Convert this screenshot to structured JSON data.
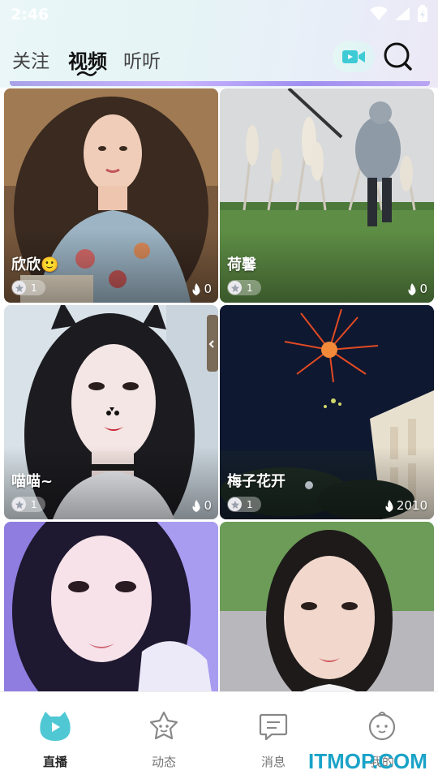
{
  "status_bar": {
    "time": "2:46",
    "icons": [
      "wifi-icon",
      "signal-icon",
      "battery-icon"
    ]
  },
  "header": {
    "tabs": [
      {
        "label": "关注",
        "active": false
      },
      {
        "label": "视频",
        "active": true
      },
      {
        "label": "听听",
        "active": false
      }
    ],
    "live_button_icon": "video-camera-icon",
    "search_icon": "search-icon"
  },
  "cards": [
    {
      "name": "欣欣🙂",
      "level": "1",
      "heat": "0"
    },
    {
      "name": "荷馨",
      "level": "1",
      "heat": "0"
    },
    {
      "name": "喵喵~",
      "level": "1",
      "heat": "0"
    },
    {
      "name": "梅子花开",
      "level": "1",
      "heat": "2010"
    },
    {
      "name": "",
      "level": "",
      "heat": ""
    },
    {
      "name": "",
      "level": "",
      "heat": ""
    }
  ],
  "bottom_nav": {
    "items": [
      {
        "label": "直播",
        "icon": "live-tv-icon",
        "active": true
      },
      {
        "label": "动态",
        "icon": "star-face-icon",
        "active": false
      },
      {
        "label": "消息",
        "icon": "message-icon",
        "active": false
      },
      {
        "label": "我的",
        "icon": "profile-face-icon",
        "active": false
      }
    ]
  },
  "watermark": "ITMOP.COM",
  "colors": {
    "accent": "#4fc3d9",
    "text_primary": "#111111",
    "text_secondary": "#777777"
  }
}
